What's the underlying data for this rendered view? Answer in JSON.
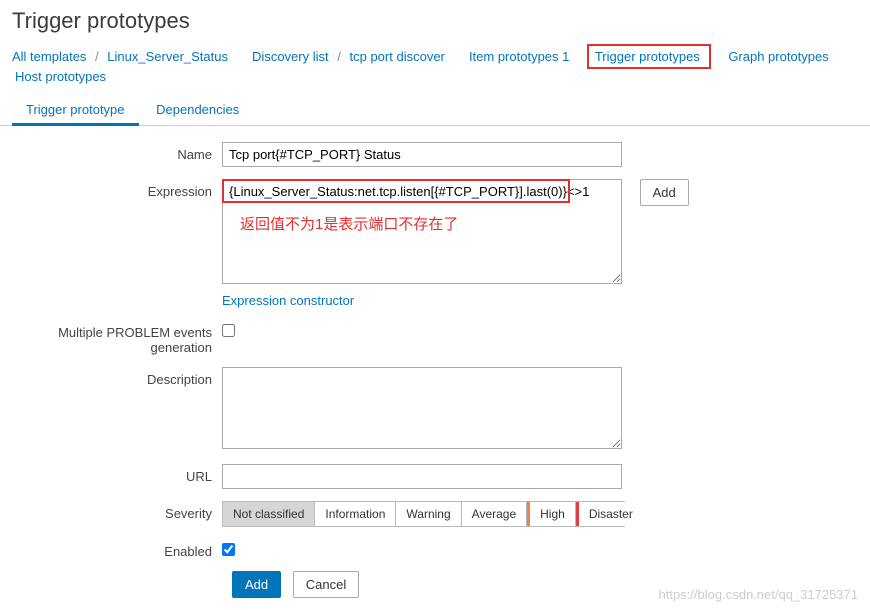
{
  "page_title": "Trigger prototypes",
  "breadcrumb": {
    "all_templates": "All templates",
    "template_name": "Linux_Server_Status",
    "discovery_list": "Discovery list",
    "discovery_rule": "tcp port discover",
    "item_proto": "Item prototypes 1",
    "trigger_proto": "Trigger prototypes",
    "graph_proto": "Graph prototypes",
    "host_proto": "Host prototypes"
  },
  "tabs": {
    "trigger_prototype": "Trigger prototype",
    "dependencies": "Dependencies"
  },
  "form": {
    "name_label": "Name",
    "name_value": "Tcp port{#TCP_PORT} Status",
    "expression_label": "Expression",
    "expression_value": "{Linux_Server_Status:net.tcp.listen[{#TCP_PORT}].last(0)}<>1",
    "expression_add_btn": "Add",
    "annotation": "返回值不为1是表示端口不存在了",
    "expr_constructor": "Expression constructor",
    "multi_problem_label": "Multiple PROBLEM events generation",
    "description_label": "Description",
    "description_value": "",
    "url_label": "URL",
    "url_value": "",
    "severity_label": "Severity",
    "severity": {
      "not_classified": "Not classified",
      "information": "Information",
      "warning": "Warning",
      "average": "Average",
      "high": "High",
      "disaster": "Disaster"
    },
    "enabled_label": "Enabled"
  },
  "buttons": {
    "add": "Add",
    "cancel": "Cancel"
  },
  "watermark": "https://blog.csdn.net/qq_31725371"
}
